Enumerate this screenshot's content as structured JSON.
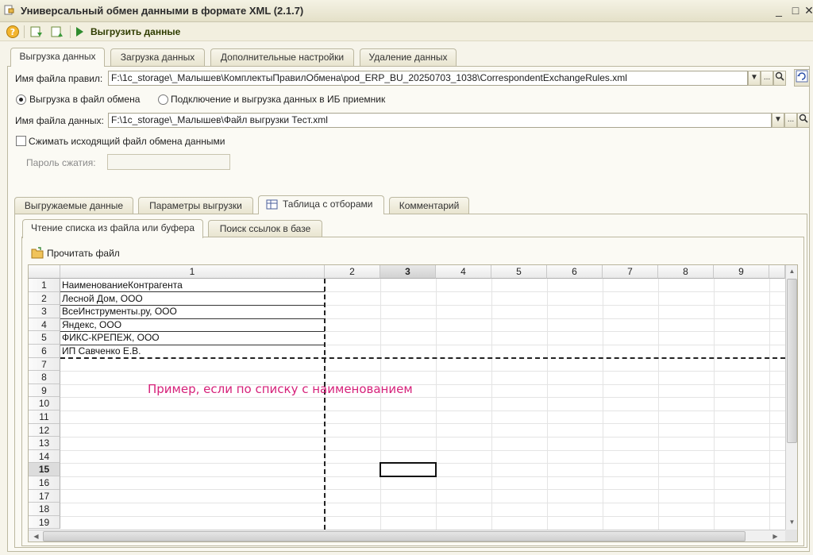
{
  "window": {
    "title": "Универсальный обмен данными в формате XML (2.1.7)"
  },
  "toolbar": {
    "export_label": "Выгрузить данные"
  },
  "main_tabs": [
    "Выгрузка данных",
    "Загрузка данных",
    "Дополнительные настройки",
    "Удаление данных"
  ],
  "form": {
    "rules_label": "Имя файла правил:",
    "rules_value": "F:\\1c_storage\\_Малышев\\КомплектыПравилОбмена\\pod_ERP_BU_20250703_1038\\CorrespondentExchangeRules.xml",
    "radio_file": "Выгрузка в файл обмена",
    "radio_ib": "Подключение и выгрузка данных в ИБ приемник",
    "data_file_label": "Имя файла данных:",
    "data_file_value": "F:\\1c_storage\\_Малышев\\Файл выгрузки Тест.xml",
    "compress_label": "Сжимать исходящий файл обмена данными",
    "password_label": "Пароль сжатия:",
    "ellipsis": "..."
  },
  "sub_tabs": [
    "Выгружаемые данные",
    "Параметры выгрузки",
    "Таблица с отборами",
    "Комментарий"
  ],
  "inner_tabs": [
    "Чтение списка из файла или буфера",
    "Поиск ссылок в базе"
  ],
  "read_file_label": "Прочитать файл",
  "sheet": {
    "columns": [
      "1",
      "2",
      "3",
      "4",
      "5",
      "6",
      "7",
      "8",
      "9"
    ],
    "rows": [
      "1",
      "2",
      "3",
      "4",
      "5",
      "6",
      "7",
      "8",
      "9",
      "10",
      "11",
      "12",
      "13",
      "14",
      "15",
      "16",
      "17",
      "18",
      "19"
    ],
    "cells": [
      "НаименованиеКонтрагента",
      "Лесной Дом, ООО",
      "ВсеИнструменты.ру, ООО",
      "Яндекс, ООО",
      "ФИКС-КРЕПЕЖ, ООО",
      "ИП Савченко Е.В."
    ]
  },
  "annotation": "Пример, если по списку с наименованием"
}
